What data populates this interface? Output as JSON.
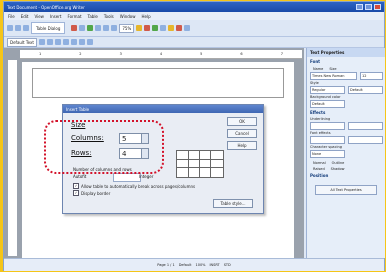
{
  "window": {
    "title": "Text Document - OpenOffice.org Writer"
  },
  "menu": [
    "File",
    "Edit",
    "View",
    "Insert",
    "Format",
    "Table",
    "Tools",
    "Window",
    "Help"
  ],
  "toolbar": {
    "doc_tab": "Table Dialog",
    "paragraph_style": "Default Text",
    "zoom": "75%",
    "font_name": "Times New Roman",
    "font_size": "12"
  },
  "ruler_numbers": [
    "1",
    "2",
    "3",
    "4",
    "5",
    "6",
    "7"
  ],
  "dialog": {
    "title": "Insert Table",
    "size_label": "Size",
    "columns_label": "Columns:",
    "columns_value": "5",
    "rows_label": "Rows:",
    "rows_value": "4",
    "ok": "OK",
    "cancel": "Cancel",
    "help": "Help",
    "options_label": "Number of columns and rows",
    "autofit_label": "Autofit",
    "autofit_unit": "Integer",
    "allow_break": "Allow table to automatically break across pages/columns",
    "border": "Display border",
    "table_style": "Table style..."
  },
  "side_panel": {
    "title": "Text Properties",
    "font_section": "Font",
    "font_label": "Name",
    "font_value": "Times New Roman",
    "size_label": "Size",
    "size_value": "12",
    "style_label": "Style",
    "style_value": "Regular",
    "weight_value": "Default",
    "bg_label": "Background color",
    "bg_value": "Default",
    "effects_section": "Effects",
    "underline_label": "Underlining",
    "case_label": "Font effects",
    "spacing_label": "Character spacing",
    "spacing_value": "None",
    "opt_normal": "Normal",
    "opt_outline": "Outline",
    "opt_raised": "Raised",
    "opt_shadow": "Shadow",
    "position_section": "Position",
    "all_button": "All Text Properties"
  },
  "status": [
    "Page 1 / 1",
    "Default",
    "100%",
    "INSRT",
    "STD"
  ],
  "colors": {
    "highlight": "#d3122a",
    "titlebar": "#1a4aa8",
    "background": "#f5c518"
  }
}
